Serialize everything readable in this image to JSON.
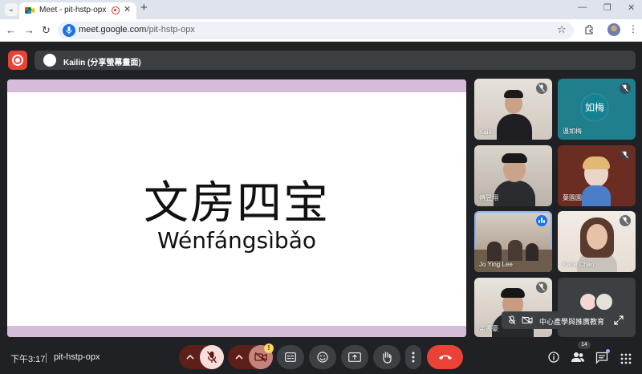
{
  "browser": {
    "tab_title": "Meet - pit-hstp-opx",
    "url_host": "meet.google.com",
    "url_path": "/pit-hstp-opx"
  },
  "meet": {
    "presenter_label": "Kailin (分享螢幕畫面)",
    "slide": {
      "title": "文房四宝",
      "pinyin": "Wénfángsìbǎo"
    },
    "participants": [
      {
        "name": "Kailin"
      },
      {
        "name": "溫如梅",
        "avatar_text": "如梅"
      },
      {
        "name": "傅昱翔"
      },
      {
        "name": "葉園園"
      },
      {
        "name": "Jo Ying Lee"
      },
      {
        "name": "Katie Chao"
      },
      {
        "name": "孟書豪"
      }
    ],
    "overflow_chip_label": "中心產學與推廣教育",
    "bottom": {
      "time": "下午3:17",
      "meeting_code": "pit-hstp-opx",
      "people_count": "14",
      "video_warning_badge": "!"
    },
    "colors": {
      "end_call": "#ea4335",
      "muted_control": "#f9dedc",
      "accent_blue": "#8ab4f8",
      "slide_band": "#d5bcd8"
    }
  }
}
